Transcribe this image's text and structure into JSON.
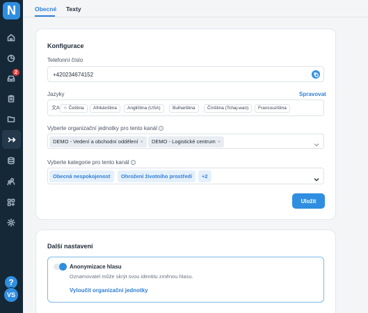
{
  "sidebar": {
    "logo": "N",
    "notification_count": "2",
    "help": "?",
    "avatar_initials": "VS"
  },
  "tabs": [
    {
      "label": "Obecné",
      "active": true
    },
    {
      "label": "Texty",
      "active": false
    }
  ],
  "config": {
    "title": "Konfigurace",
    "phone_label": "Telefonní číslo",
    "phone_value": "+420234674152",
    "languages_label": "Jazyky",
    "manage_link": "Spravovat",
    "languages": [
      "☆ Čeština",
      "Afrikánština",
      "Angličtina (USA)",
      "Bulharština",
      "Čínština (Tchaj-wan)",
      "Francouzština"
    ],
    "org_units_label": "Vyberte organizační jednotky pro tento kanál",
    "org_units": [
      "DEMO - Vedení a obchodní oddělení",
      "DEMO - Logistické centrum"
    ],
    "categories_label": "Vyberte kategorie pro tento kanál",
    "categories": [
      "Obecná nespokojenost",
      "Ohrožení životního prostředí",
      "+2"
    ],
    "save_label": "Uložit"
  },
  "more": {
    "title": "Další nastavení",
    "anon_title": "Anonymizace hlasu",
    "anon_desc": "Oznamovatel může skrýt svou identitu změnou hlasu.",
    "exclude_link": "Vyloučit organizační jednotky"
  },
  "colors": {
    "accent": "#2f8ee0",
    "sidebar_bg": "#142838",
    "badge": "#e8413c"
  }
}
